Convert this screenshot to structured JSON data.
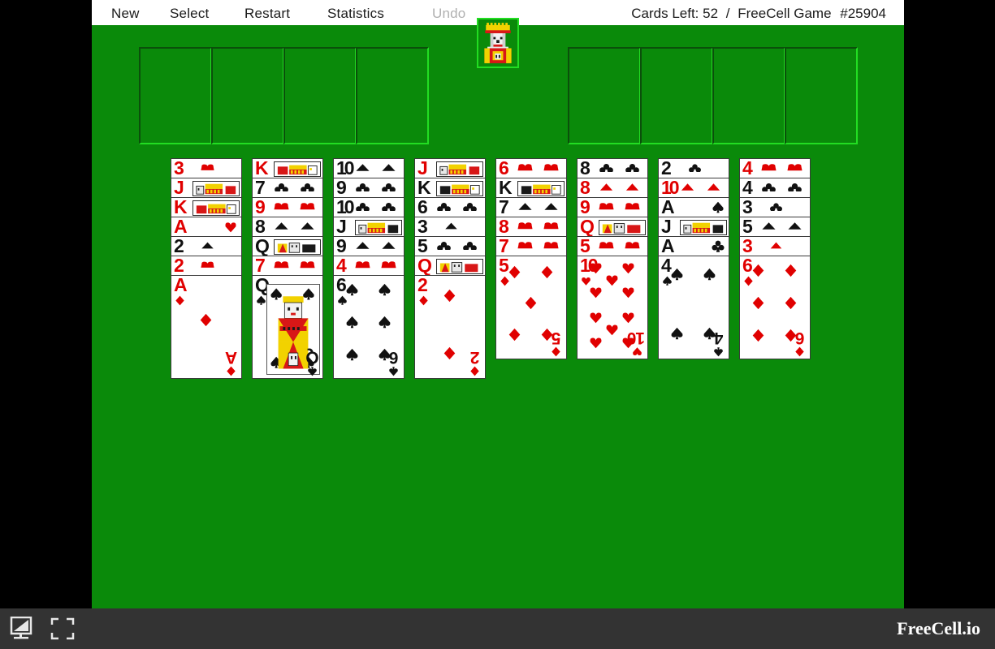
{
  "menu": {
    "items": [
      {
        "id": "new",
        "label": "New",
        "disabled": false
      },
      {
        "id": "select",
        "label": "Select",
        "disabled": false
      },
      {
        "id": "restart",
        "label": "Restart",
        "disabled": false
      },
      {
        "id": "statistics",
        "label": "Statistics",
        "disabled": false
      },
      {
        "id": "undo",
        "label": "Undo",
        "disabled": true
      }
    ],
    "status": {
      "cards_left_label": "Cards Left:",
      "cards_left_value": "52",
      "separator": "/",
      "game_label": "FreeCell Game",
      "game_number": "#25904"
    }
  },
  "board": {
    "felt_color": "#0a8a0a",
    "cell_border_dark": "#0b4f0b",
    "cell_border_light": "#22dd22",
    "free_cells": [
      {
        "name": "free-cell-1",
        "card": null
      },
      {
        "name": "free-cell-2",
        "card": null
      },
      {
        "name": "free-cell-3",
        "card": null
      },
      {
        "name": "free-cell-4",
        "card": null
      }
    ],
    "foundations": [
      {
        "name": "foundation-spades",
        "card": null
      },
      {
        "name": "foundation-hearts",
        "card": null
      },
      {
        "name": "foundation-diamonds",
        "card": null
      },
      {
        "name": "foundation-clubs",
        "card": null
      }
    ],
    "logo_icon": "king-icon"
  },
  "tableau": {
    "columns": [
      {
        "name": "tableau-column-1",
        "cards": [
          {
            "rank": "3",
            "suit": "hearts",
            "color": "red"
          },
          {
            "rank": "J",
            "suit": "hearts",
            "color": "red"
          },
          {
            "rank": "K",
            "suit": "hearts",
            "color": "red"
          },
          {
            "rank": "A",
            "suit": "hearts",
            "color": "red"
          },
          {
            "rank": "2",
            "suit": "spades",
            "color": "black"
          },
          {
            "rank": "2",
            "suit": "hearts",
            "color": "red"
          },
          {
            "rank": "A",
            "suit": "diamonds",
            "color": "red"
          }
        ]
      },
      {
        "name": "tableau-column-2",
        "cards": [
          {
            "rank": "K",
            "suit": "hearts",
            "color": "red"
          },
          {
            "rank": "7",
            "suit": "clubs",
            "color": "black"
          },
          {
            "rank": "9",
            "suit": "hearts",
            "color": "red"
          },
          {
            "rank": "8",
            "suit": "spades",
            "color": "black"
          },
          {
            "rank": "Q",
            "suit": "spades",
            "color": "black"
          },
          {
            "rank": "7",
            "suit": "hearts",
            "color": "red"
          },
          {
            "rank": "Q",
            "suit": "spades",
            "color": "black"
          }
        ]
      },
      {
        "name": "tableau-column-3",
        "cards": [
          {
            "rank": "10",
            "suit": "spades",
            "color": "black"
          },
          {
            "rank": "9",
            "suit": "clubs",
            "color": "black"
          },
          {
            "rank": "10",
            "suit": "clubs",
            "color": "black"
          },
          {
            "rank": "J",
            "suit": "spades",
            "color": "black"
          },
          {
            "rank": "9",
            "suit": "spades",
            "color": "black"
          },
          {
            "rank": "4",
            "suit": "hearts",
            "color": "red"
          },
          {
            "rank": "6",
            "suit": "spades",
            "color": "black"
          }
        ]
      },
      {
        "name": "tableau-column-4",
        "cards": [
          {
            "rank": "J",
            "suit": "hearts",
            "color": "red"
          },
          {
            "rank": "K",
            "suit": "spades",
            "color": "black"
          },
          {
            "rank": "6",
            "suit": "clubs",
            "color": "black"
          },
          {
            "rank": "3",
            "suit": "spades",
            "color": "black"
          },
          {
            "rank": "5",
            "suit": "clubs",
            "color": "black"
          },
          {
            "rank": "Q",
            "suit": "hearts",
            "color": "red"
          },
          {
            "rank": "2",
            "suit": "diamonds",
            "color": "red"
          }
        ]
      },
      {
        "name": "tableau-column-5",
        "cards": [
          {
            "rank": "6",
            "suit": "hearts",
            "color": "red"
          },
          {
            "rank": "K",
            "suit": "clubs",
            "color": "black"
          },
          {
            "rank": "7",
            "suit": "spades",
            "color": "black"
          },
          {
            "rank": "8",
            "suit": "hearts",
            "color": "red"
          },
          {
            "rank": "7",
            "suit": "hearts",
            "color": "red"
          },
          {
            "rank": "5",
            "suit": "diamonds",
            "color": "red"
          }
        ]
      },
      {
        "name": "tableau-column-6",
        "cards": [
          {
            "rank": "8",
            "suit": "clubs",
            "color": "black"
          },
          {
            "rank": "8",
            "suit": "diamonds",
            "color": "red"
          },
          {
            "rank": "9",
            "suit": "hearts",
            "color": "red"
          },
          {
            "rank": "Q",
            "suit": "diamonds",
            "color": "red"
          },
          {
            "rank": "5",
            "suit": "hearts",
            "color": "red"
          },
          {
            "rank": "10",
            "suit": "hearts",
            "color": "red"
          }
        ]
      },
      {
        "name": "tableau-column-7",
        "cards": [
          {
            "rank": "2",
            "suit": "clubs",
            "color": "black"
          },
          {
            "rank": "10",
            "suit": "diamonds",
            "color": "red"
          },
          {
            "rank": "A",
            "suit": "spades",
            "color": "black"
          },
          {
            "rank": "J",
            "suit": "spades",
            "color": "black"
          },
          {
            "rank": "A",
            "suit": "clubs",
            "color": "black"
          },
          {
            "rank": "4",
            "suit": "spades",
            "color": "black"
          }
        ]
      },
      {
        "name": "tableau-column-8",
        "cards": [
          {
            "rank": "4",
            "suit": "hearts",
            "color": "red"
          },
          {
            "rank": "4",
            "suit": "clubs",
            "color": "black"
          },
          {
            "rank": "3",
            "suit": "clubs",
            "color": "black"
          },
          {
            "rank": "5",
            "suit": "spades",
            "color": "black"
          },
          {
            "rank": "3",
            "suit": "diamonds",
            "color": "red"
          },
          {
            "rank": "6",
            "suit": "diamonds",
            "color": "red"
          }
        ]
      }
    ]
  },
  "bottom_bar": {
    "background": "#333333",
    "icons": [
      {
        "name": "screen-size-icon",
        "label": "screen-size"
      },
      {
        "name": "fullscreen-icon",
        "label": "fullscreen"
      }
    ],
    "brand": "FreeCell.io"
  }
}
